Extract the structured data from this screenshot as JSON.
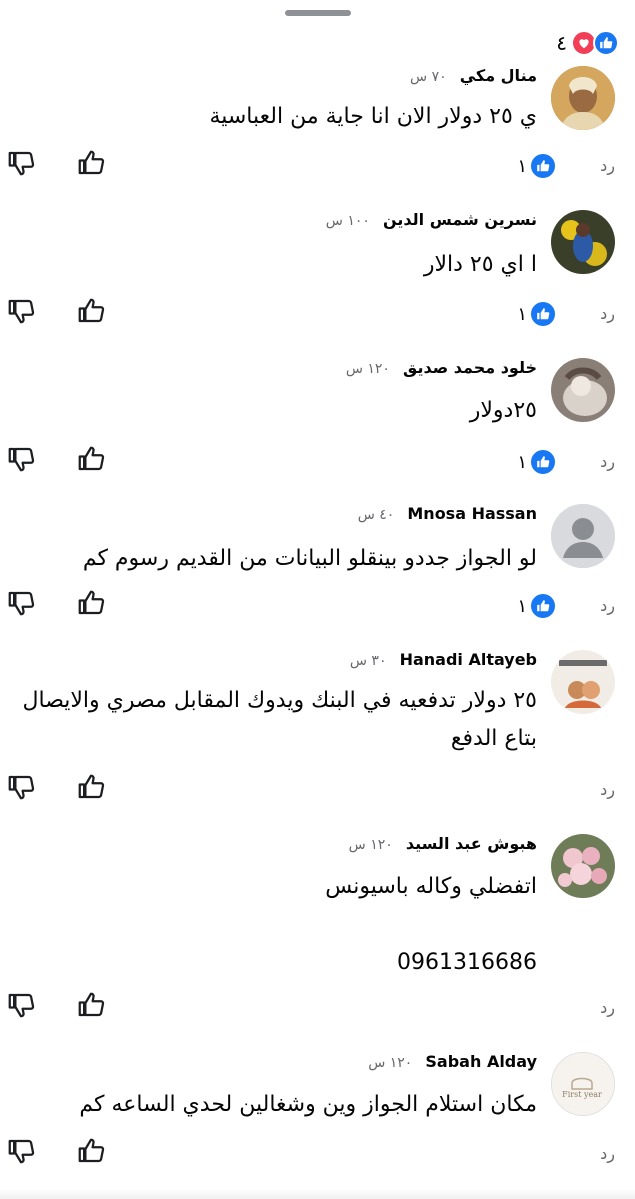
{
  "reactions_summary": {
    "count": "٤",
    "icons": [
      "heart-icon",
      "like-icon"
    ],
    "colors": {
      "like": "#1877f2",
      "heart": "#f33e58"
    }
  },
  "comments": [
    {
      "name": "منال مكي",
      "time": "٧٠ س",
      "text": [
        "ي ٢٥ دولار الان انا جاية من العباسية"
      ],
      "likes": "١",
      "reply": "رد"
    },
    {
      "name": "نسرين شمس الدين",
      "time": "١٠٠ س",
      "text": [
        "ا اي ٢٥ دالار"
      ],
      "likes": "١",
      "reply": "رد"
    },
    {
      "name": "خلود محمد صديق",
      "time": "١٢٠ س",
      "text": [
        "٢٥دولار"
      ],
      "likes": "١",
      "reply": "رد"
    },
    {
      "name": "Mnosa Hassan",
      "time": "٤٠ س",
      "text": [
        "لو الجواز جددو بينقلو البيانات من القديم رسوم كم"
      ],
      "likes": "١",
      "reply": "رد"
    },
    {
      "name": "Hanadi Altayeb",
      "time": "٣٠ س",
      "text": [
        "٢٥ دولار تدفعيه في البنك ويدوك المقابل مصري والايصال",
        "بتاع الدفع"
      ],
      "likes": "",
      "reply": "رد"
    },
    {
      "name": "هبوش عبد السيد",
      "time": "١٢٠ س",
      "text": [
        "اتفضلي وكاله باسيونس",
        "",
        "0961316686"
      ],
      "likes": "",
      "reply": "رد"
    },
    {
      "name": "Sabah Alday",
      "time": "١٢٠ س",
      "text": [
        "مكان استلام الجواز وين وشغالين لحدي الساعه كم"
      ],
      "likes": "",
      "reply": "رد"
    }
  ],
  "avatar_texts": {
    "sabah": "First year"
  }
}
